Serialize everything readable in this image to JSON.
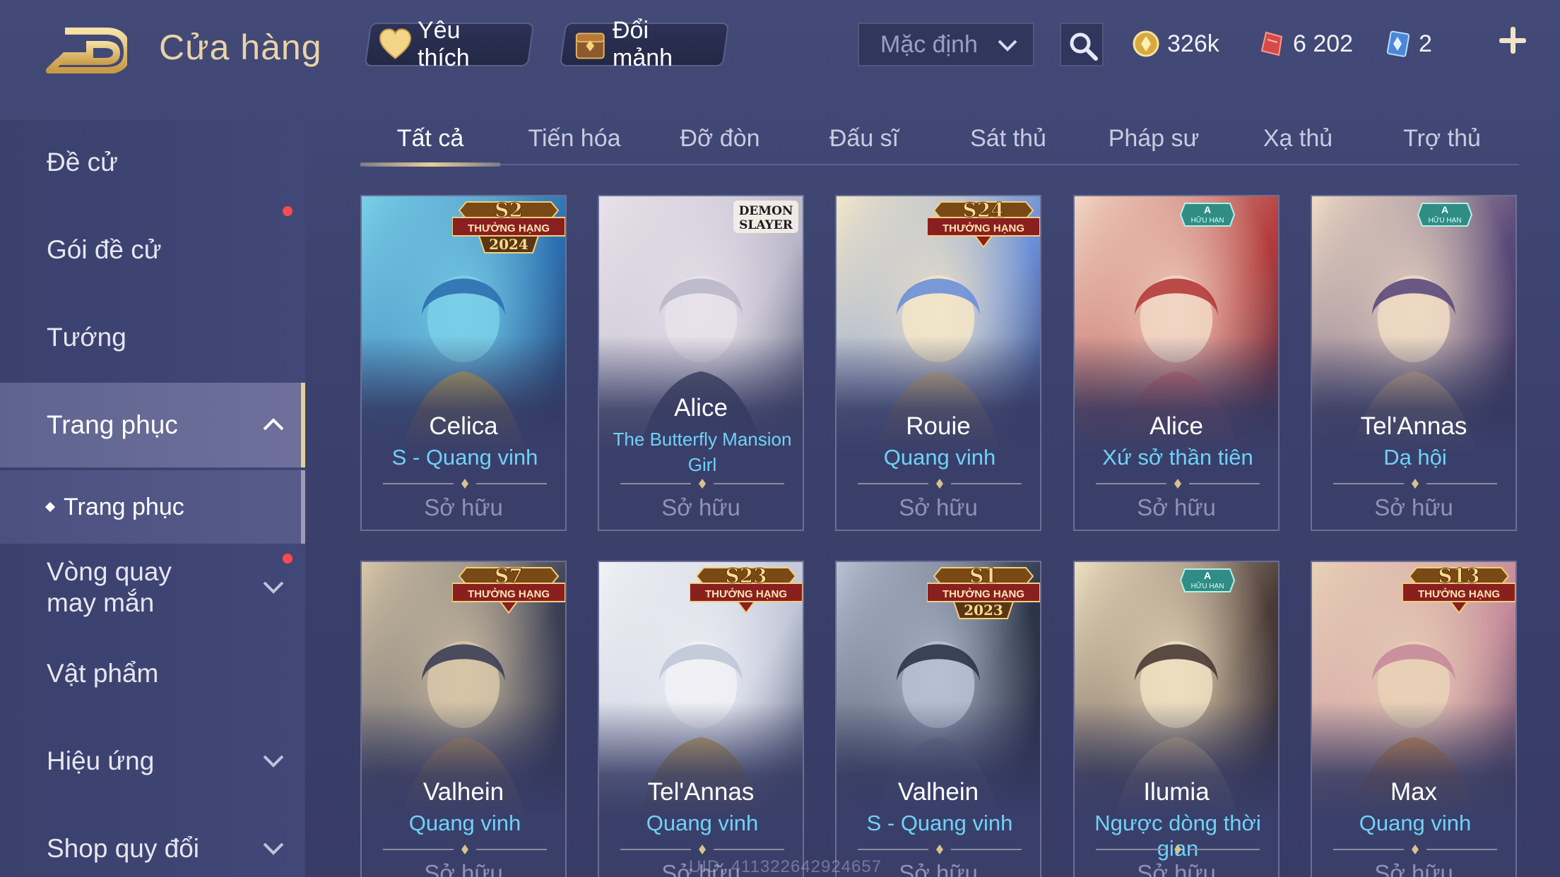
{
  "header": {
    "title": "Cửa hàng",
    "favorite_label": "Yêu thích",
    "exchange_label": "Đổi mảnh",
    "sort_selected": "Mặc định",
    "currencies": {
      "gold": "326k",
      "voucher": "6 202",
      "gem": "2"
    }
  },
  "sidebar": {
    "items": [
      {
        "label": "Đề cử"
      },
      {
        "label": "Gói đề cử"
      },
      {
        "label": "Tướng"
      },
      {
        "label": "Trang phục"
      },
      {
        "label": "Vòng quay may mắn"
      },
      {
        "label": "Vật phẩm"
      },
      {
        "label": "Hiệu ứng"
      },
      {
        "label": "Shop quy đổi"
      }
    ],
    "sub_item": "Trang phục"
  },
  "tabs": [
    "Tất cả",
    "Tiến hóa",
    "Đỡ đòn",
    "Đấu sĩ",
    "Sát thủ",
    "Pháp sư",
    "Xạ thủ",
    "Trợ thủ"
  ],
  "badge_text": {
    "rank": "THƯỞNG HẠNG",
    "limited": "HỮU HẠN",
    "limited_letter": "A",
    "collab": "DEMON SLAYER"
  },
  "cards": [
    {
      "hero": "Celica",
      "skin": "S - Quang vinh",
      "owned": "Sở hữu",
      "season": "S2",
      "year": "2024",
      "theme": [
        "#2d6fb0",
        "#e8b840",
        "#7ad0e8"
      ]
    },
    {
      "hero": "Alice",
      "skin": "The Butterfly Mansion Girl",
      "owned": "Sở hữu",
      "collab": true,
      "theme": [
        "#b9b7c9",
        "#2a2f4d",
        "#e8e2ea"
      ]
    },
    {
      "hero": "Rouie",
      "skin": "Quang vinh",
      "owned": "Sở hữu",
      "season": "S24",
      "theme": [
        "#6b8fd8",
        "#e2c07a",
        "#f3e6c8"
      ]
    },
    {
      "hero": "Alice",
      "skin": "Xứ sở thần tiên",
      "owned": "Sở hữu",
      "limited": true,
      "theme": [
        "#b33b3b",
        "#e06a6a",
        "#f2d7c6"
      ]
    },
    {
      "hero": "Tel'Annas",
      "skin": "Dạ hội",
      "owned": "Sở hữu",
      "limited": true,
      "theme": [
        "#5b4a7a",
        "#e4c08a",
        "#f0dcc4"
      ]
    },
    {
      "hero": "Valhein",
      "skin": "Quang vinh",
      "owned": "Sở hữu",
      "season": "S7",
      "theme": [
        "#3b3f55",
        "#c29a5a",
        "#d8c7a8"
      ]
    },
    {
      "hero": "Tel'Annas",
      "skin": "Quang vinh",
      "owned": "Sở hữu",
      "season": "S23",
      "theme": [
        "#bfc6d8",
        "#caa042",
        "#f1f1f6"
      ]
    },
    {
      "hero": "Valhein",
      "skin": "S - Quang vinh",
      "owned": "Sở hữu",
      "season": "S1",
      "year": "2023",
      "theme": [
        "#2c3448",
        "#6c7890",
        "#b9c2d4"
      ]
    },
    {
      "hero": "Ilumia",
      "skin": "Ngược dòng thời gian",
      "owned": "Sở hữu",
      "limited": true,
      "theme": [
        "#4a3a36",
        "#d6b98c",
        "#f0e1c2"
      ]
    },
    {
      "hero": "Max",
      "skin": "Quang vinh",
      "owned": "Sở hữu",
      "season": "S13",
      "theme": [
        "#c58a9a",
        "#d88c3a",
        "#e9d1b7"
      ]
    }
  ],
  "footer": {
    "uid": "UID: 411322642924657"
  }
}
